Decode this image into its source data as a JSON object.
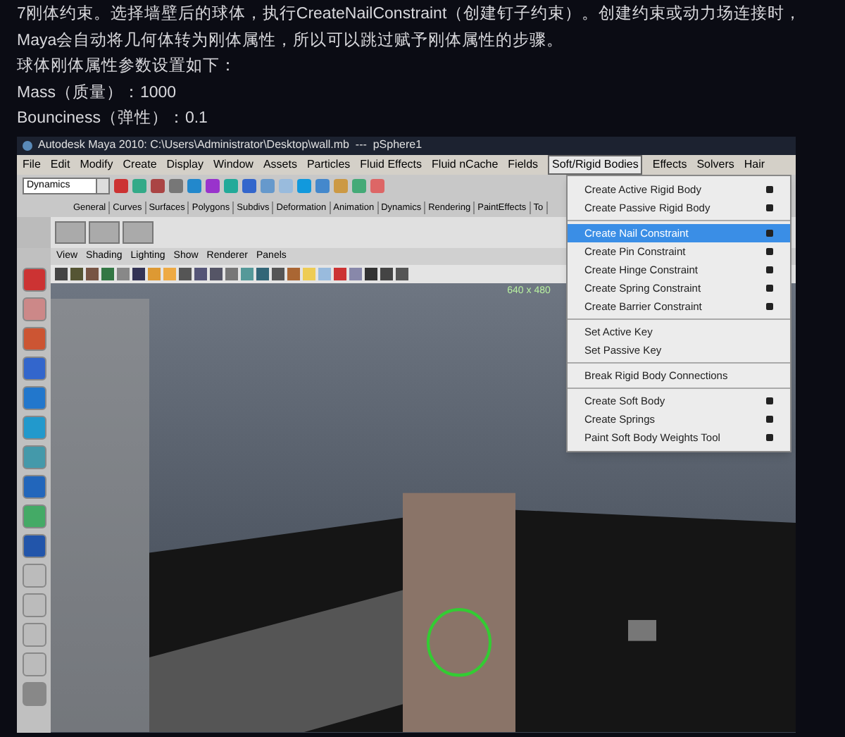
{
  "article": {
    "paragraphs": [
      "7刚体约束。选择墙壁后的球体，执行CreateNailConstraint（创建钉子约束）。创建约束或动力场连接时，Maya会自动将几何体转为刚体属性，所以可以跳过赋予刚体属性的步骤。",
      "球体刚体属性参数设置如下：",
      "Mass（质量）：1000",
      "Bounciness（弹性）：0.1"
    ]
  },
  "maya_window": {
    "title": "Autodesk Maya 2010: C:\\Users\\Administrator\\Desktop\\wall.mb  ---  pSphere1",
    "menu_bar": [
      {
        "label": "File",
        "selected": false
      },
      {
        "label": "Edit",
        "selected": false
      },
      {
        "label": "Modify",
        "selected": false
      },
      {
        "label": "Create",
        "selected": false
      },
      {
        "label": "Display",
        "selected": false
      },
      {
        "label": "Window",
        "selected": false
      },
      {
        "label": "Assets",
        "selected": false
      },
      {
        "label": "Particles",
        "selected": false
      },
      {
        "label": "Fluid Effects",
        "selected": false
      },
      {
        "label": "Fluid nCache",
        "selected": false
      },
      {
        "label": "Fields",
        "selected": false
      },
      {
        "label": "Soft/Rigid Bodies",
        "selected": true
      },
      {
        "label": "Effects",
        "selected": false
      },
      {
        "label": "Solvers",
        "selected": false
      },
      {
        "label": "Hair",
        "selected": false
      }
    ],
    "mode_dropdown": "Dynamics",
    "shelf_tabs": [
      "General",
      "Curves",
      "Surfaces",
      "Polygons",
      "Subdivs",
      "Deformation",
      "Animation",
      "Dynamics",
      "Rendering",
      "PaintEffects",
      "To"
    ],
    "panel_menu": [
      "View",
      "Shading",
      "Lighting",
      "Show",
      "Renderer",
      "Panels"
    ],
    "resolution": "640 x 480",
    "dropdown_menu": [
      [
        {
          "label": "Create Active Rigid Body",
          "option_box": true,
          "selected": false
        },
        {
          "label": "Create Passive Rigid Body",
          "option_box": true,
          "selected": false
        }
      ],
      [
        {
          "label": "Create Nail Constraint",
          "option_box": true,
          "selected": true
        },
        {
          "label": "Create Pin Constraint",
          "option_box": true,
          "selected": false
        },
        {
          "label": "Create Hinge Constraint",
          "option_box": true,
          "selected": false
        },
        {
          "label": "Create Spring Constraint",
          "option_box": true,
          "selected": false
        },
        {
          "label": "Create Barrier Constraint",
          "option_box": true,
          "selected": false
        }
      ],
      [
        {
          "label": "Set Active Key",
          "option_box": false,
          "selected": false
        },
        {
          "label": "Set Passive Key",
          "option_box": false,
          "selected": false
        }
      ],
      [
        {
          "label": "Break Rigid Body Connections",
          "option_box": false,
          "selected": false
        }
      ],
      [
        {
          "label": "Create Soft Body",
          "option_box": true,
          "selected": false
        },
        {
          "label": "Create Springs",
          "option_box": true,
          "selected": false
        },
        {
          "label": "Paint Soft Body Weights Tool",
          "option_box": true,
          "selected": false
        }
      ]
    ]
  }
}
